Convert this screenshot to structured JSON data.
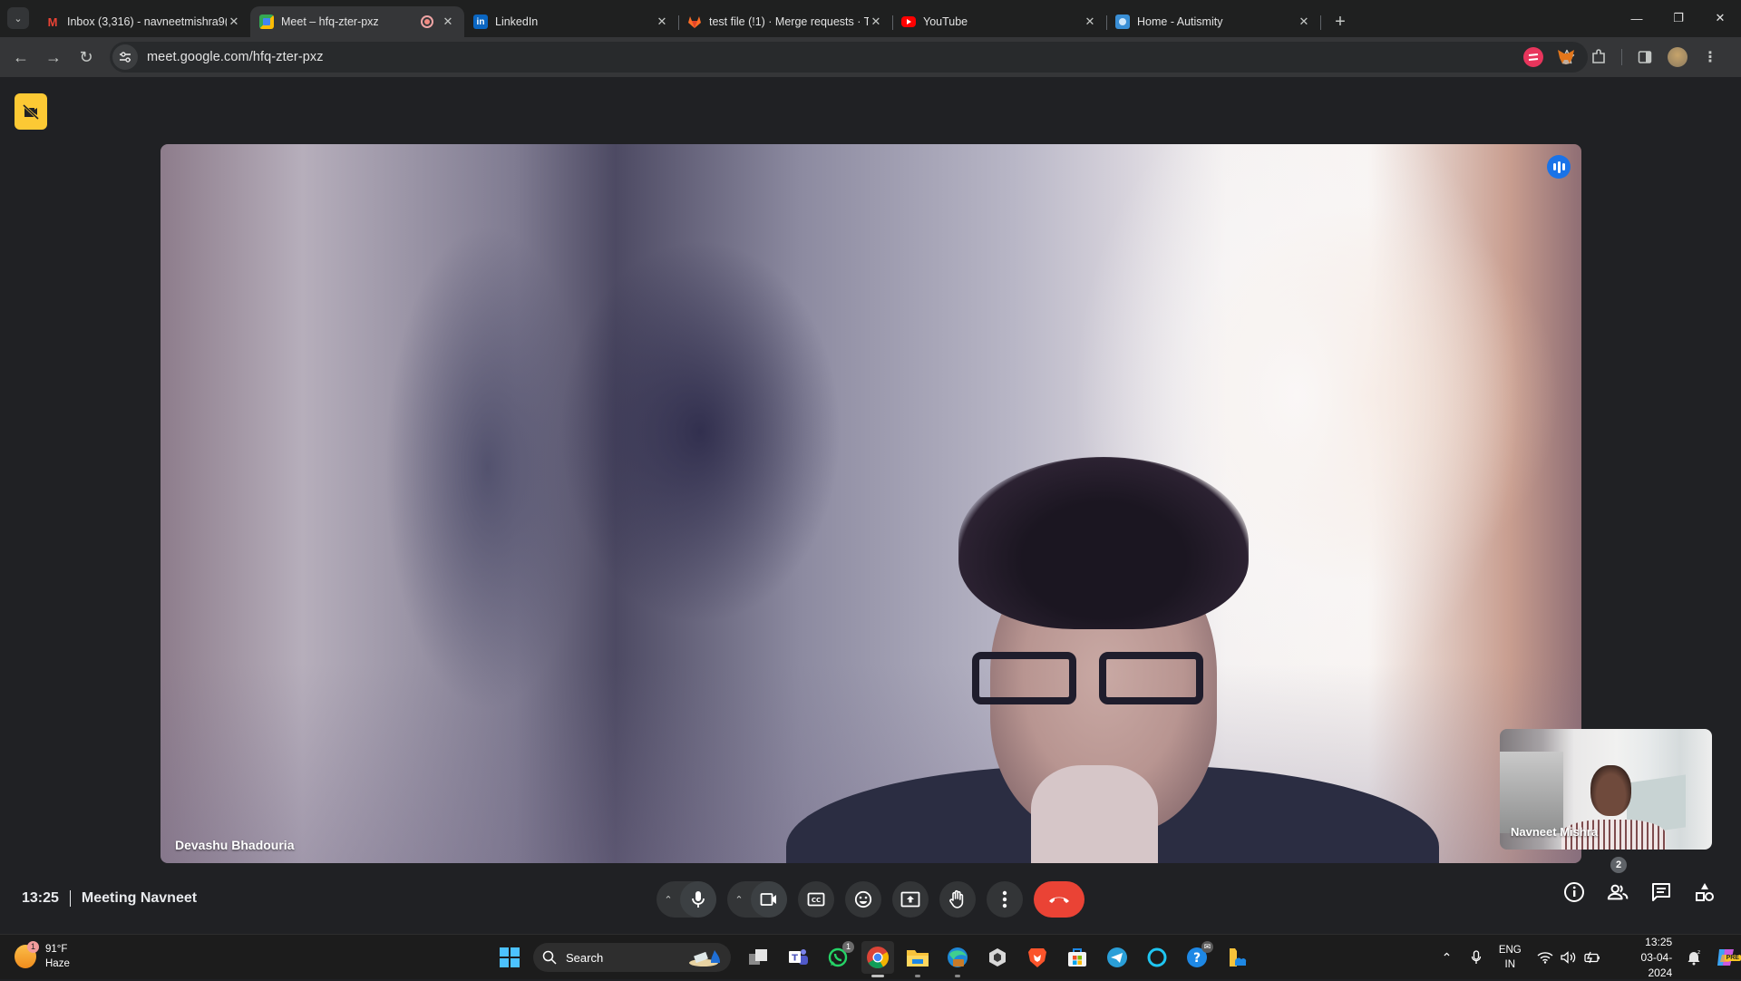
{
  "browser": {
    "tabs": [
      {
        "title": "Inbox (3,316) - navneetmishra9(",
        "favicon": "gmail-icon",
        "active": false
      },
      {
        "title": "Meet – hfq-zter-pxz",
        "favicon": "google-meet-icon",
        "active": true,
        "recording": true
      },
      {
        "title": "LinkedIn",
        "favicon": "linkedin-icon",
        "active": false
      },
      {
        "title": "test file (!1) · Merge requests · T",
        "favicon": "gitlab-icon",
        "active": false
      },
      {
        "title": "YouTube",
        "favicon": "youtube-icon",
        "active": false
      },
      {
        "title": "Home - Autismity",
        "favicon": "autismity-icon",
        "active": false
      }
    ],
    "url": "meet.google.com/hfq-zter-pxz",
    "close_glyph": "✕",
    "new_tab_glyph": "+"
  },
  "meet": {
    "main_participant": "Devashu Bhadouria",
    "self_participant": "Navneet Mishra",
    "time": "13:25",
    "meeting_name": "Meeting Navneet",
    "participant_count": "2",
    "colors": {
      "end_call": "#ea4335",
      "speaking": "#1a73e8",
      "camera_off_badge": "#fcc934"
    }
  },
  "taskbar": {
    "weather_temp": "91°F",
    "weather_desc": "Haze",
    "weather_badge": "1",
    "search_label": "Search",
    "whatsapp_badge": "1",
    "lang_top": "ENG",
    "lang_bottom": "IN",
    "clock_time": "13:25",
    "clock_date": "03-04-2024",
    "copilot_label": "PRE"
  }
}
